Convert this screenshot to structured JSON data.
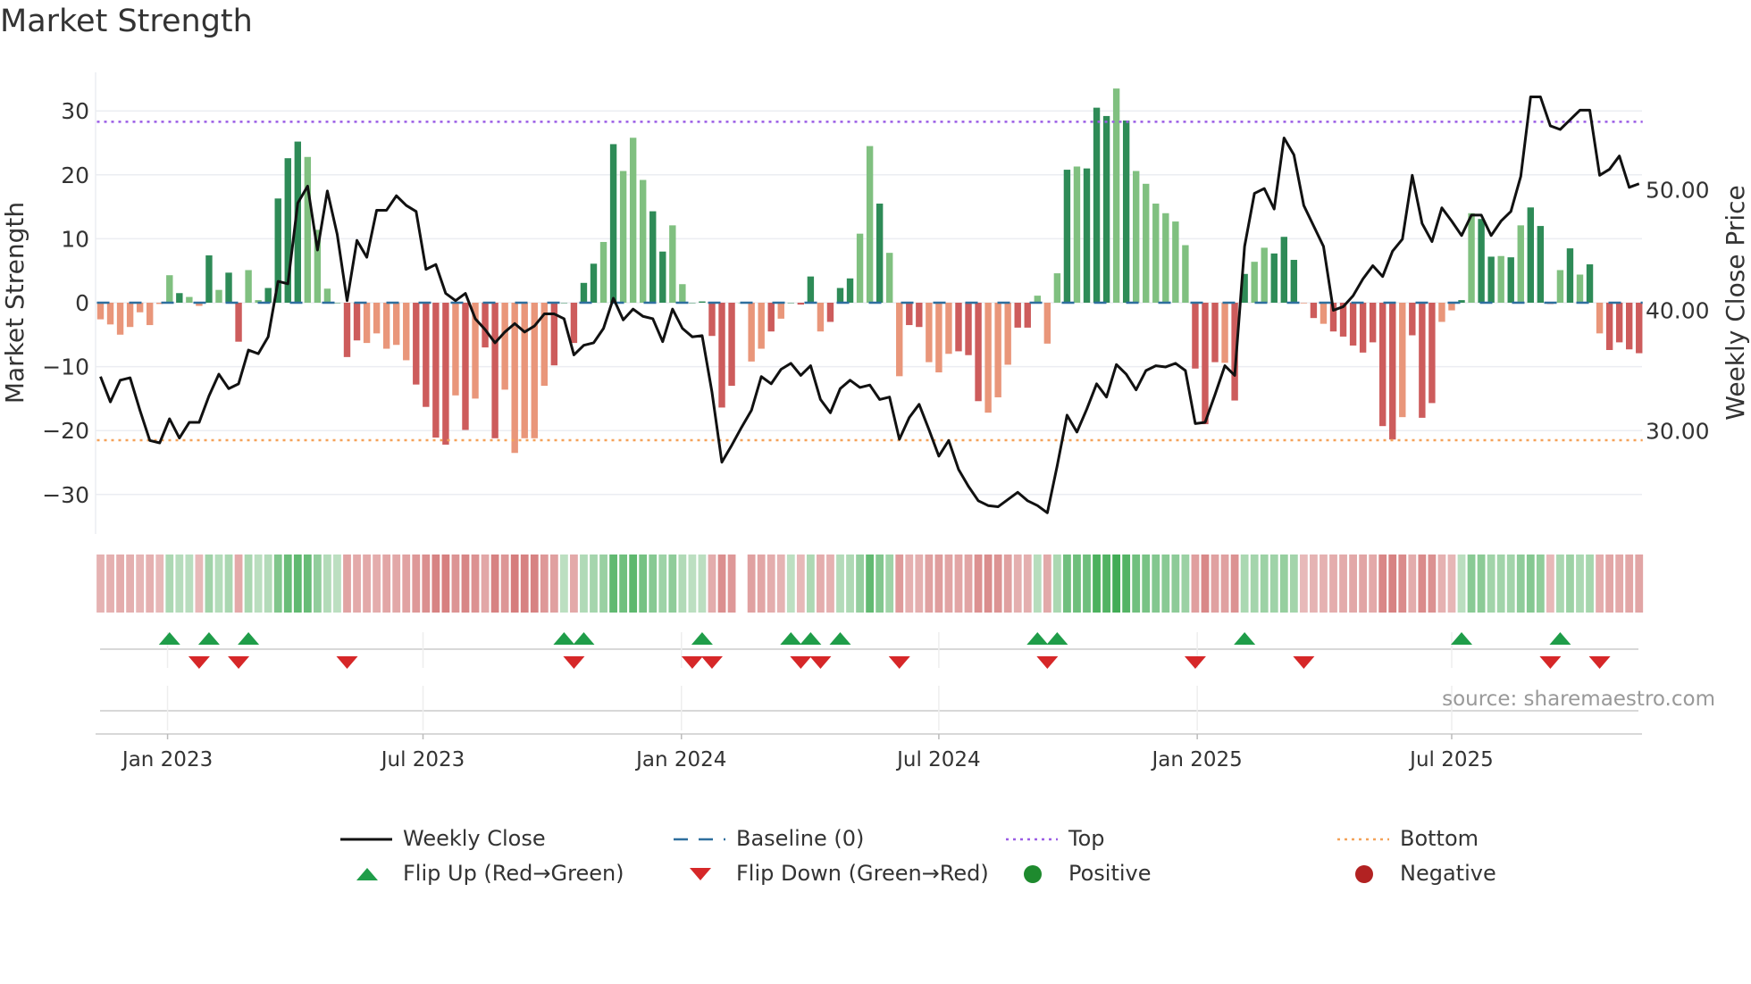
{
  "title": "Market Strength",
  "source": "source: sharemaestro.com",
  "colors": {
    "strong_green": "#2e8b57",
    "light_green": "#80c080",
    "strong_red": "#cd5c5c",
    "light_red": "#e9967a",
    "price_line": "#111111",
    "baseline": "#2e6f9e",
    "top": "#9b5de5",
    "bottom": "#f4a259",
    "flip_up": "#1f9d49",
    "flip_down": "#d62728"
  },
  "legend": [
    {
      "key": "weekly_close",
      "label": "Weekly Close"
    },
    {
      "key": "baseline",
      "label": "Baseline (0)"
    },
    {
      "key": "top",
      "label": "Top"
    },
    {
      "key": "bottom",
      "label": "Bottom"
    },
    {
      "key": "flip_up",
      "label": "Flip Up (Red→Green)"
    },
    {
      "key": "flip_down",
      "label": "Flip Down (Green→Red)"
    },
    {
      "key": "positive",
      "label": "Positive"
    },
    {
      "key": "negative",
      "label": "Negative"
    }
  ],
  "chart_data": {
    "type": "bar",
    "title": "Market Strength",
    "ylabel": "Market Strength",
    "y2label": "Weekly Close Price",
    "ylim": [
      -37,
      36
    ],
    "y2lim": [
      21.3,
      61.0
    ],
    "yticks": [
      -30,
      -20,
      -10,
      0,
      10,
      20,
      30
    ],
    "y2ticks": [
      "30.00",
      "40.00",
      "50.00"
    ],
    "y2tick_values": [
      30,
      40,
      50
    ],
    "top_level": 28.3,
    "bottom_level": -21.5,
    "xticks": [
      {
        "label": "Jan 2023",
        "week": 6.8
      },
      {
        "label": "Jul 2023",
        "week": 32.7
      },
      {
        "label": "Jan 2024",
        "week": 58.9
      },
      {
        "label": "Jul 2024",
        "week": 85.0
      },
      {
        "label": "Jan 2025",
        "week": 111.2
      },
      {
        "label": "Jul 2025",
        "week": 137.0
      }
    ],
    "strength": [
      -2.6,
      -3.4,
      -5,
      -3.8,
      -1.5,
      -3.5,
      -0.2,
      4.3,
      1.5,
      0.9,
      -0.5,
      7.4,
      2,
      4.7,
      -6.1,
      5.1,
      0.4,
      2.3,
      16.3,
      22.6,
      25.2,
      22.8,
      11.4,
      2.2,
      0,
      -8.5,
      -5.9,
      -6.3,
      -4.8,
      -7.2,
      -6.6,
      -9,
      -12.8,
      -16.3,
      -21.1,
      -22.2,
      -14.5,
      -19.9,
      -15,
      -7,
      -21.2,
      -13.6,
      -23.5,
      -21.2,
      -21.2,
      -13,
      -9.8,
      0,
      -6.3,
      3.1,
      6.1,
      9.5,
      24.8,
      20.6,
      25.8,
      19.2,
      14.3,
      8,
      12.1,
      2.9,
      0,
      0.2,
      -5.2,
      -16.4,
      -13,
      0,
      -9.2,
      -7.2,
      -4.5,
      -2.5,
      0,
      -0.3,
      4.1,
      -4.5,
      -3,
      2.3,
      3.8,
      10.8,
      24.5,
      15.5,
      7.8,
      -11.5,
      -3.5,
      -3.8,
      -9.3,
      -10.9,
      -8,
      -7.6,
      -8.2,
      -15.4,
      -17.2,
      -14.8,
      -9.7,
      -3.9,
      -3.9,
      1.1,
      -6.4,
      4.6,
      20.8,
      21.3,
      21,
      30.5,
      29.2,
      33.5,
      28.5,
      20.6,
      18.6,
      15.5,
      14,
      12.7,
      9,
      -10.3,
      -19,
      -9.3,
      -9.4,
      -15.3,
      4.5,
      6.4,
      8.6,
      7.7,
      10.3,
      6.7,
      -0.1,
      -2.4,
      -3.3,
      -4.5,
      -5.3,
      -6.7,
      -7.8,
      -6.2,
      -19.3,
      -21.4,
      -17.9,
      -5.1,
      -18,
      -15.7,
      -3,
      -1.2,
      0.4,
      14,
      13.1,
      7.2,
      7.3,
      7.1,
      12.1,
      14.9,
      12,
      -0.2,
      5.1,
      8.5,
      4.4,
      6,
      -4.8,
      -7.4,
      -6.2,
      -7.3,
      -7.9
    ],
    "shade": "lllllllldlldlddllddddllldddlllllddddldlddllllldddddldlllddlldddddllldldddldddlldllddllldddlllddllldldddldlllllldddlddlldddldldddddddldddlldlddldldddldldlddddd",
    "weekly_close": [
      34.5,
      32.4,
      34.2,
      34.4,
      31.7,
      29.2,
      29,
      31,
      29.4,
      30.7,
      30.7,
      32.9,
      34.7,
      33.5,
      33.9,
      36.7,
      36.4,
      37.8,
      42.4,
      42.2,
      48.9,
      50.3,
      45,
      49.9,
      46.3,
      40.8,
      45.8,
      44.4,
      48.3,
      48.3,
      49.5,
      48.7,
      48.2,
      43.4,
      43.8,
      41.4,
      40.8,
      41.4,
      39.3,
      38.4,
      37.3,
      38.2,
      38.9,
      38.2,
      38.7,
      39.7,
      39.7,
      39.3,
      36.3,
      37.1,
      37.3,
      38.5,
      41,
      39.2,
      40.1,
      39.5,
      39.3,
      37.4,
      40.1,
      38.5,
      37.8,
      37.9,
      33.2,
      27.4,
      28.8,
      30.3,
      31.7,
      34.5,
      33.9,
      35.1,
      35.6,
      34.6,
      35.4,
      32.6,
      31.5,
      33.5,
      34.2,
      33.6,
      33.8,
      32.6,
      32.8,
      29.3,
      31.1,
      32.2,
      30.1,
      27.9,
      29.2,
      26.8,
      25.4,
      24.2,
      23.8,
      23.7,
      24.3,
      24.9,
      24.2,
      23.8,
      23.2,
      27.1,
      31.3,
      29.9,
      31.8,
      33.9,
      32.8,
      35.5,
      34.7,
      33.4,
      35,
      35.4,
      35.3,
      35.6,
      35,
      30.6,
      30.7,
      33,
      35.4,
      34.6,
      45.3,
      49.7,
      50.1,
      48.4,
      54.3,
      52.9,
      48.7,
      47,
      45.3,
      40,
      40.3,
      41.2,
      42.6,
      43.7,
      42.8,
      44.9,
      45.9,
      51.2,
      47.2,
      45.7,
      48.5,
      47.4,
      46.2,
      47.9,
      47.9,
      46.2,
      47.4,
      48.2,
      51.1,
      57.7,
      57.7,
      55.3,
      55,
      55.8,
      56.6,
      56.6,
      51.2,
      51.7,
      52.8,
      50.2,
      50.5
    ],
    "strip_missing_weeks": [
      65
    ],
    "flip_up_weeks": [
      7,
      11,
      15,
      47,
      49,
      61,
      70,
      72,
      75,
      95,
      97,
      116,
      138,
      148
    ],
    "flip_down_weeks": [
      10,
      14,
      25,
      48,
      60,
      62,
      71,
      73,
      81,
      96,
      111,
      122,
      147,
      152
    ]
  }
}
